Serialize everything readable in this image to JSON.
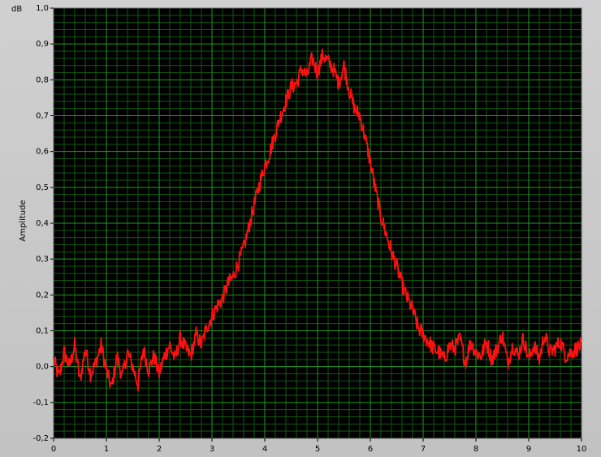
{
  "colors": {
    "background": "#c8c8c8",
    "plot_background": "#000000",
    "grid_major": "#1f9a1f",
    "grid_minor": "#0f5a0f",
    "trace": "#ff1010"
  },
  "chart_data": {
    "type": "line",
    "title": "",
    "xlabel": "",
    "ylabel": "Amplitude",
    "y_unit": "dB",
    "xlim": [
      0,
      10
    ],
    "ylim": [
      -0.2,
      1.0
    ],
    "grid": true,
    "legend": "none",
    "x_ticks": [
      "0",
      "1",
      "2",
      "3",
      "4",
      "5",
      "6",
      "7",
      "8",
      "9",
      "10"
    ],
    "y_ticks": [
      "-0,2",
      "-0,1",
      "0,0",
      "0,1",
      "0,2",
      "0,3",
      "0,4",
      "0,5",
      "0,6",
      "0,7",
      "0,8",
      "0,9",
      "1,0"
    ],
    "x_tick_values": [
      0,
      1,
      2,
      3,
      4,
      5,
      6,
      7,
      8,
      9,
      10
    ],
    "y_tick_values": [
      -0.2,
      -0.1,
      0,
      0.1,
      0.2,
      0.3,
      0.4,
      0.5,
      0.6,
      0.7,
      0.8,
      0.9,
      1.0
    ],
    "series": [
      {
        "x": [
          0.0,
          0.1,
          0.2,
          0.3,
          0.4,
          0.5,
          0.6,
          0.7,
          0.8,
          0.9,
          1.0,
          1.1,
          1.2,
          1.3,
          1.4,
          1.5,
          1.6,
          1.7,
          1.8,
          1.9,
          2.0,
          2.1,
          2.2,
          2.3,
          2.4,
          2.5,
          2.6,
          2.7,
          2.8,
          2.9,
          3.0,
          3.1,
          3.2,
          3.3,
          3.4,
          3.5,
          3.6,
          3.7,
          3.8,
          3.9,
          4.0,
          4.1,
          4.2,
          4.3,
          4.4,
          4.5,
          4.6,
          4.7,
          4.8,
          4.9,
          5.0,
          5.1,
          5.2,
          5.3,
          5.4,
          5.5,
          5.6,
          5.7,
          5.8,
          5.9,
          6.0,
          6.1,
          6.2,
          6.3,
          6.4,
          6.5,
          6.6,
          6.7,
          6.8,
          6.9,
          7.0,
          7.1,
          7.2,
          7.3,
          7.4,
          7.5,
          7.6,
          7.7,
          7.8,
          7.9,
          8.0,
          8.1,
          8.2,
          8.3,
          8.4,
          8.5,
          8.6,
          8.7,
          8.8,
          8.9,
          9.0,
          9.1,
          9.2,
          9.3,
          9.4,
          9.5,
          9.6,
          9.7,
          9.8,
          9.9,
          10.0
        ],
        "y": [
          0.02,
          -0.03,
          0.04,
          0.0,
          0.06,
          -0.04,
          0.05,
          -0.02,
          0.01,
          0.06,
          -0.01,
          -0.06,
          0.03,
          -0.03,
          0.04,
          0.0,
          -0.05,
          0.05,
          -0.01,
          0.03,
          -0.02,
          0.03,
          0.06,
          0.02,
          0.08,
          0.05,
          0.03,
          0.09,
          0.06,
          0.11,
          0.14,
          0.17,
          0.19,
          0.23,
          0.25,
          0.29,
          0.33,
          0.39,
          0.45,
          0.51,
          0.56,
          0.6,
          0.65,
          0.7,
          0.74,
          0.78,
          0.79,
          0.83,
          0.81,
          0.86,
          0.82,
          0.87,
          0.85,
          0.83,
          0.79,
          0.84,
          0.77,
          0.72,
          0.7,
          0.64,
          0.57,
          0.49,
          0.42,
          0.37,
          0.32,
          0.28,
          0.23,
          0.19,
          0.16,
          0.11,
          0.09,
          0.07,
          0.05,
          0.04,
          0.02,
          0.06,
          0.05,
          0.08,
          0.01,
          0.07,
          0.04,
          0.03,
          0.07,
          0.02,
          0.05,
          0.09,
          0.01,
          0.06,
          0.03,
          0.08,
          0.02,
          0.06,
          0.02,
          0.09,
          0.04,
          0.05,
          0.07,
          0.03,
          0.04,
          0.05,
          0.06
        ]
      }
    ]
  }
}
